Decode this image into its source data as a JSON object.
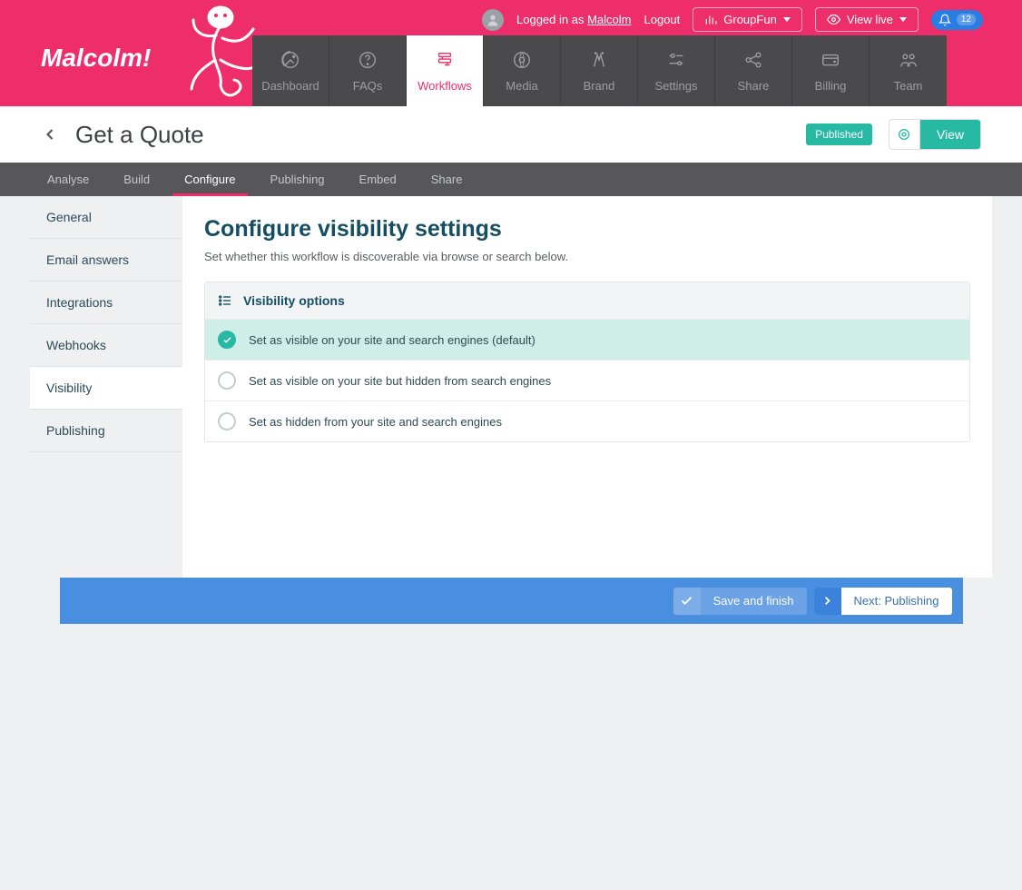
{
  "brand": {
    "name": "Malcolm!"
  },
  "header": {
    "logged_in_prefix": "Logged in as ",
    "user_name": "Malcolm",
    "logout_label": "Logout",
    "org_button": "GroupFun",
    "view_live_label": "View live",
    "notif_count": "12"
  },
  "mainnav": [
    {
      "key": "dashboard",
      "label": "Dashboard",
      "active": false
    },
    {
      "key": "faqs",
      "label": "FAQs",
      "active": false
    },
    {
      "key": "workflows",
      "label": "Workflows",
      "active": true
    },
    {
      "key": "media",
      "label": "Media",
      "active": false
    },
    {
      "key": "brand",
      "label": "Brand",
      "active": false
    },
    {
      "key": "settings",
      "label": "Settings",
      "active": false
    },
    {
      "key": "share",
      "label": "Share",
      "active": false
    },
    {
      "key": "billing",
      "label": "Billing",
      "active": false
    },
    {
      "key": "team",
      "label": "Team",
      "active": false
    }
  ],
  "titlebar": {
    "page_title": "Get a Quote",
    "status_badge": "Published",
    "view_button": "View"
  },
  "subtabs": [
    {
      "key": "analyse",
      "label": "Analyse",
      "active": false
    },
    {
      "key": "build",
      "label": "Build",
      "active": false
    },
    {
      "key": "configure",
      "label": "Configure",
      "active": true
    },
    {
      "key": "publishing",
      "label": "Publishing",
      "active": false
    },
    {
      "key": "embed",
      "label": "Embed",
      "active": false
    },
    {
      "key": "share",
      "label": "Share",
      "active": false
    }
  ],
  "sidenav": [
    {
      "key": "general",
      "label": "General",
      "active": false
    },
    {
      "key": "email",
      "label": "Email answers",
      "active": false
    },
    {
      "key": "integrations",
      "label": "Integrations",
      "active": false
    },
    {
      "key": "webhooks",
      "label": "Webhooks",
      "active": false
    },
    {
      "key": "visibility",
      "label": "Visibility",
      "active": true
    },
    {
      "key": "publishing",
      "label": "Publishing",
      "active": false
    }
  ],
  "panel": {
    "title": "Configure visibility settings",
    "subtitle": "Set whether this workflow is discoverable via browse or search below.",
    "card_title": "Visibility options",
    "options": [
      {
        "label": "Set as visible on your site and search engines (default)",
        "selected": true
      },
      {
        "label": "Set as visible on your site but hidden from search engines",
        "selected": false
      },
      {
        "label": "Set as hidden from your site and search engines",
        "selected": false
      }
    ]
  },
  "footer": {
    "save_label": "Save and finish",
    "next_label": "Next: Publishing"
  }
}
